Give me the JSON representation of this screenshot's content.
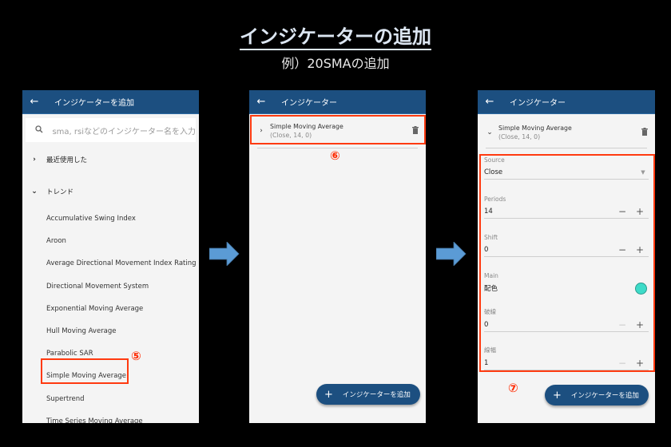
{
  "header": {
    "title": "インジケーターの追加",
    "subtitle": "例）20SMAの追加"
  },
  "screen1": {
    "appbar_title": "インジケーターを追加",
    "search_placeholder": "sma, rsiなどのインジケーター名を入力",
    "groups": [
      {
        "label": "最近使用した",
        "expanded": false
      },
      {
        "label": "トレンド",
        "expanded": true
      }
    ],
    "items": [
      "Accumulative Swing Index",
      "Aroon",
      "Average Directional Movement Index Rating",
      "Directional Movement System",
      "Exponential Moving Average",
      "Hull Moving Average",
      "Parabolic SAR",
      "Simple Moving Average",
      "Supertrend",
      "Time Series Moving Average"
    ],
    "step_label": "⑤"
  },
  "screen2": {
    "appbar_title": "インジケーター",
    "indicator": {
      "name": "Simple Moving Average",
      "params": "(Close, 14, 0)"
    },
    "step_label": "⑥",
    "fab_label": "インジケーターを追加"
  },
  "screen3": {
    "appbar_title": "インジケーター",
    "indicator": {
      "name": "Simple Moving Average",
      "params": "(Close, 14, 0)"
    },
    "fields": {
      "source": {
        "label": "Source",
        "value": "Close"
      },
      "periods": {
        "label": "Periods",
        "value": "14"
      },
      "shift": {
        "label": "Shift",
        "value": "0"
      },
      "main": {
        "label": "Main",
        "value": "配色",
        "color": "#3ddbc8"
      },
      "dashed": {
        "label": "破線",
        "value": "0"
      },
      "width": {
        "label": "線幅",
        "value": "1"
      }
    },
    "step_label": "⑦",
    "fab_label": "インジケーターを追加"
  },
  "icons": {
    "back": "←",
    "search": "🔍",
    "chevron_right": "›",
    "chevron_down": "⌄",
    "trash": "🗑",
    "plus": "+",
    "minus": "−",
    "dropdown": "▼"
  },
  "colors": {
    "appbar": "#1c4f80",
    "highlight": "#ff3a10",
    "arrow": "#5b9bd5"
  }
}
